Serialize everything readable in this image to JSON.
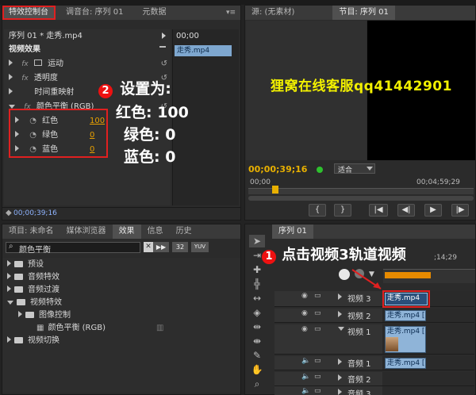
{
  "effect_controls": {
    "tabs": [
      "特效控制台",
      "调音台: 序列 01",
      "元数据"
    ],
    "clip_label": "序列 01 * 走秀.mp4",
    "time_label": "00;00",
    "clip_chip": "走秀.mp4",
    "section_title": "视频效果",
    "effects": [
      "运动",
      "透明度",
      "时间重映射",
      "颜色平衡 (RGB)"
    ],
    "params": [
      {
        "label": "红色",
        "value": "100"
      },
      {
        "label": "绿色",
        "value": "0"
      },
      {
        "label": "蓝色",
        "value": "0"
      }
    ],
    "timecode": "00;00;39;16"
  },
  "annotation_2": {
    "number": "2",
    "title": "设置为:",
    "lines": [
      "红色: 100",
      "绿色: 0",
      "蓝色: 0"
    ]
  },
  "source_monitor": {
    "tabs": [
      "源: (无素材)",
      "节目: 序列 01"
    ],
    "overlay_text": "狸窝在线客服qq41442901",
    "timecode_left": "00;00;39;16",
    "fit_label": "适合",
    "time_mid": "00;00",
    "time_right": "00;04;59;29"
  },
  "project_panel": {
    "tabs": [
      "项目: 未命名",
      "媒体浏览器",
      "效果",
      "信息",
      "历史"
    ],
    "search_value": "颜色平衡",
    "badges": [
      "32",
      "YUV"
    ],
    "tree": [
      {
        "label": "预设",
        "indent": 0,
        "kind": "folder"
      },
      {
        "label": "音频特效",
        "indent": 0,
        "kind": "folder"
      },
      {
        "label": "音频过渡",
        "indent": 0,
        "kind": "folder"
      },
      {
        "label": "视频特效",
        "indent": 0,
        "kind": "folder-open"
      },
      {
        "label": "图像控制",
        "indent": 1,
        "kind": "folder"
      },
      {
        "label": "颜色平衡 (RGB)",
        "indent": 2,
        "kind": "effect"
      },
      {
        "label": "视频切换",
        "indent": 0,
        "kind": "folder"
      }
    ]
  },
  "timeline": {
    "tab": "序列 01",
    "time_right": ";14;29",
    "annotation_1": {
      "number": "1",
      "text": "点击视频3轨道视频"
    },
    "tracks": [
      {
        "name": "视频 3",
        "clip": "走秀.mp4"
      },
      {
        "name": "视频 2",
        "clip": "走秀.mp4 ["
      },
      {
        "name": "视频 1",
        "clip": "走秀.mp4 ["
      },
      {
        "name": "音频 1",
        "clip": "走秀.mp4 ["
      },
      {
        "name": "音频 2",
        "clip": ""
      },
      {
        "name": "音频 3",
        "clip": ""
      }
    ]
  },
  "colors": {
    "accent_orange": "#e8a000",
    "annotation_red": "#e02020",
    "clip_blue": "#8fb4d8",
    "overlay_yellow": "#f2f000"
  }
}
